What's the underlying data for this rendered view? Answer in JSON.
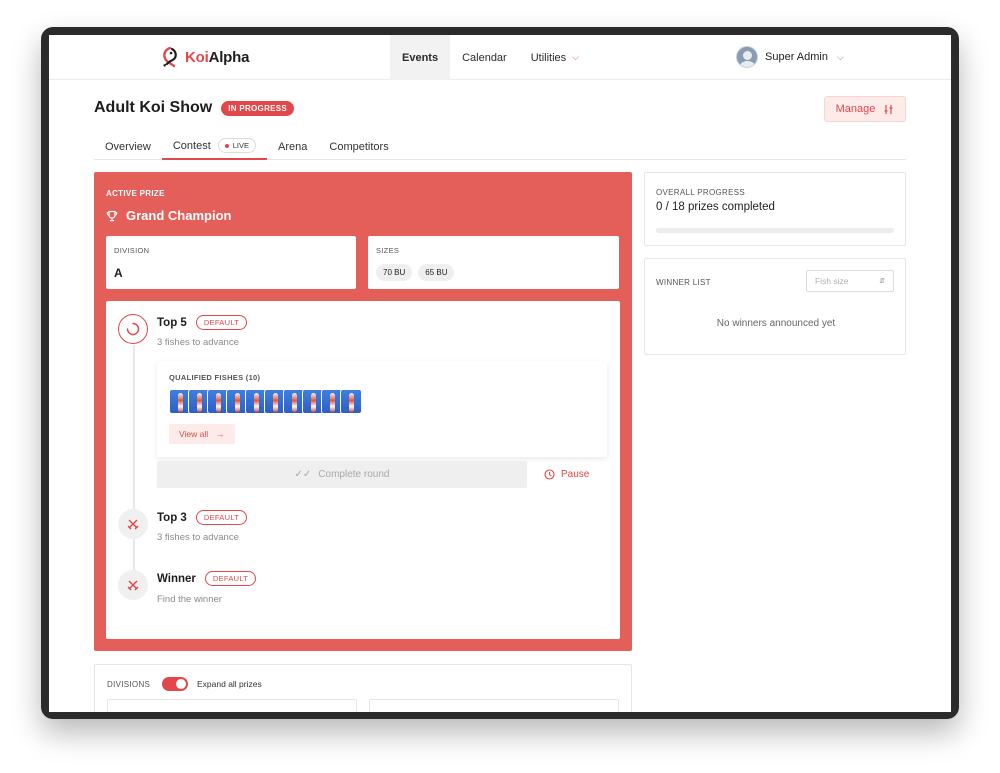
{
  "app": {
    "logo_prefix": "Koi",
    "logo_suffix": "Alpha",
    "accent": "#e2474a"
  },
  "nav": {
    "tabs": [
      {
        "label": "Events",
        "active": true
      },
      {
        "label": "Calendar",
        "active": false
      },
      {
        "label": "Utilities",
        "active": false,
        "has_dropdown": true
      }
    ],
    "user_name": "Super Admin"
  },
  "page": {
    "title": "Adult Koi Show",
    "status_badge": "IN PROGRESS",
    "manage_label": "Manage",
    "subtabs": [
      {
        "label": "Overview"
      },
      {
        "label": "Contest",
        "badge": "LIVE",
        "active": true
      },
      {
        "label": "Arena"
      },
      {
        "label": "Competitors"
      }
    ]
  },
  "active_prize": {
    "eyebrow": "ACTIVE PRIZE",
    "name": "Grand Champion",
    "division_label": "DIVISION",
    "division_value": "A",
    "sizes_label": "SIZES",
    "sizes": [
      "70 BU",
      "65 BU"
    ]
  },
  "rounds": [
    {
      "name": "Top 5",
      "badge": "DEFAULT",
      "subtitle": "3 fishes to advance",
      "state": "active",
      "qualified_label": "QUALIFIED FISHES (10)",
      "qualified_count": 10,
      "view_all_label": "View all",
      "complete_label": "Complete round",
      "pause_label": "Pause"
    },
    {
      "name": "Top 3",
      "badge": "DEFAULT",
      "subtitle": "3 fishes to advance",
      "state": "pending"
    },
    {
      "name": "Winner",
      "badge": "DEFAULT",
      "subtitle": "Find the winner",
      "state": "pending"
    }
  ],
  "overall_progress": {
    "label": "OVERALL PROGRESS",
    "text": "0 / 18 prizes completed",
    "completed": 0,
    "total": 18,
    "fraction": 0
  },
  "winner_list": {
    "label": "WINNER LIST",
    "select_placeholder": "Fish size",
    "empty_text": "No winners announced yet"
  },
  "divisions": {
    "label": "DIVISIONS",
    "toggle_on": true,
    "toggle_label": "Expand all prizes"
  }
}
